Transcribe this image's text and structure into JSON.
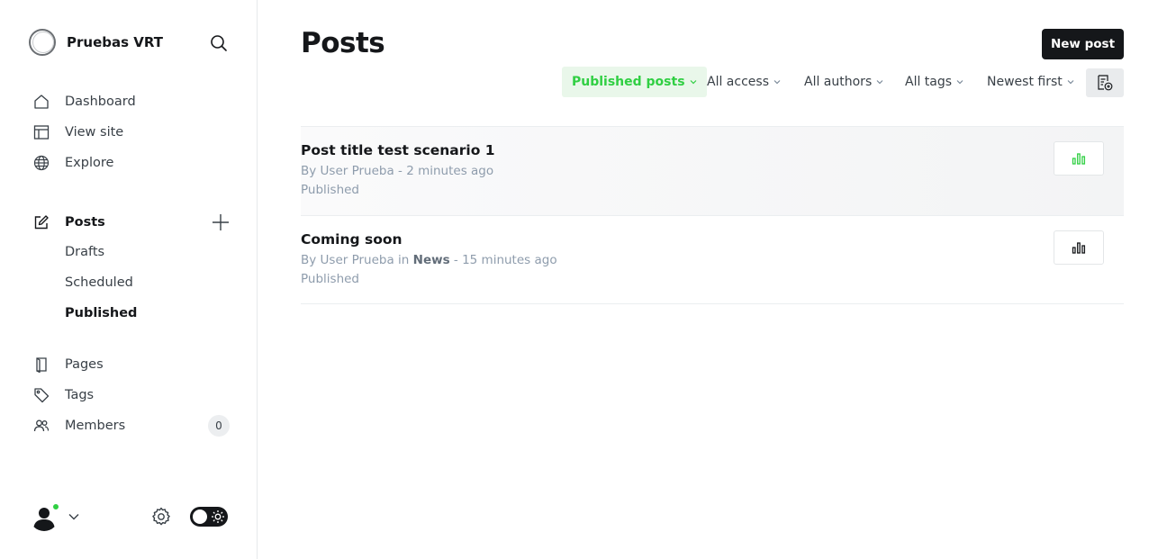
{
  "brand": {
    "name": "Pruebas VRT"
  },
  "sidebar": {
    "items": [
      {
        "label": "Dashboard",
        "icon": "home-icon"
      },
      {
        "label": "View site",
        "icon": "view-site-icon"
      },
      {
        "label": "Explore",
        "icon": "globe-icon"
      },
      {
        "label": "Posts",
        "icon": "edit-icon"
      },
      {
        "label": "Pages",
        "icon": "page-icon"
      },
      {
        "label": "Tags",
        "icon": "tag-icon"
      },
      {
        "label": "Members",
        "icon": "members-icon"
      }
    ],
    "post_subitems": [
      {
        "label": "Drafts"
      },
      {
        "label": "Scheduled"
      },
      {
        "label": "Published"
      }
    ],
    "members_count": "0"
  },
  "header": {
    "title": "Posts",
    "new_post_label": "New post"
  },
  "filters": {
    "type": "Published posts",
    "access": "All access",
    "authors": "All authors",
    "tags": "All tags",
    "order": "Newest first"
  },
  "posts": [
    {
      "title": "Post title test scenario 1",
      "meta_prefix": "By User Prueba",
      "meta_tag_prefix": "",
      "meta_tag": "",
      "meta_suffix": " - 2 minutes ago",
      "status": "Published"
    },
    {
      "title": "Coming soon",
      "meta_prefix": "By User Prueba",
      "meta_tag_prefix": " in ",
      "meta_tag": "News",
      "meta_suffix": " - 15 minutes ago",
      "status": "Published"
    }
  ],
  "colors": {
    "accent_green": "#30cf43",
    "dark": "#15171a",
    "muted": "#8e9cac"
  }
}
